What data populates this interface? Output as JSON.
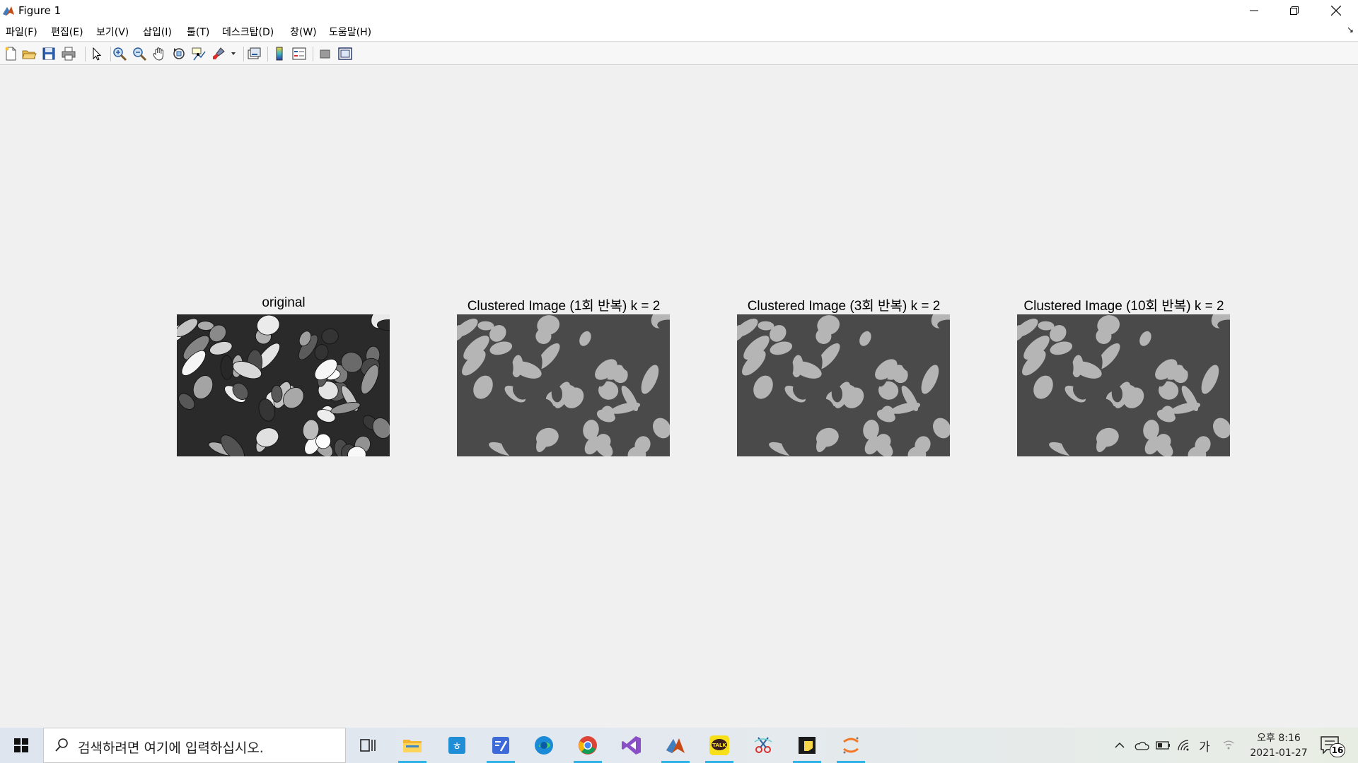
{
  "window": {
    "title": "Figure 1",
    "controls": [
      "minimize",
      "restore",
      "close"
    ]
  },
  "menu": {
    "items": [
      {
        "label": "파일(F)"
      },
      {
        "label": "편집(E)"
      },
      {
        "label": "보기(V)"
      },
      {
        "label": "삽입(I)"
      },
      {
        "label": "툴(T)"
      },
      {
        "label": "데스크탑(D)"
      },
      {
        "label": "창(W)"
      },
      {
        "label": "도움말(H)"
      }
    ],
    "dock_arrow": "↘"
  },
  "toolbar": {
    "buttons": [
      "new-figure-icon",
      "open-file-icon",
      "save-icon",
      "print-icon",
      "pointer-icon",
      "zoom-in-icon",
      "zoom-out-icon",
      "pan-hand-icon",
      "rotate-3d-icon",
      "data-cursor-icon",
      "brush-icon",
      "link-plot-icon",
      "colorbar-icon",
      "legend-icon",
      "hide-plot-tools-icon",
      "show-plot-tools-icon"
    ]
  },
  "figure": {
    "axes": [
      {
        "title": "original",
        "kind": "original"
      },
      {
        "title": "Clustered Image (1회 반복) k = 2",
        "kind": "clustered"
      },
      {
        "title": "Clustered Image (3회 반복) k = 2",
        "kind": "clustered"
      },
      {
        "title": "Clustered Image (10회 반복) k = 2",
        "kind": "clustered"
      }
    ],
    "colors": {
      "cluster_dark": "#4a4a4a",
      "cluster_light": "#b5b5b5"
    }
  },
  "taskbar": {
    "search_placeholder": "검색하려면 여기에 입력하십시오.",
    "apps": [
      "task-view-icon",
      "file-explorer-icon",
      "hangul-icon",
      "notepad-icon",
      "edge-icon",
      "chrome-icon",
      "visual-studio-icon",
      "matlab-icon",
      "kakaotalk-icon",
      "snipping-icon",
      "sticky-notes-icon",
      "jupyter-icon"
    ],
    "tray": [
      "chevron-up-icon",
      "onedrive-icon",
      "battery-icon",
      "wifi-icon",
      "ime-icon",
      "network-icon"
    ],
    "ime_label": "가",
    "clock": {
      "time": "오후 8:16",
      "date": "2021-01-27"
    },
    "notifications": "16"
  }
}
